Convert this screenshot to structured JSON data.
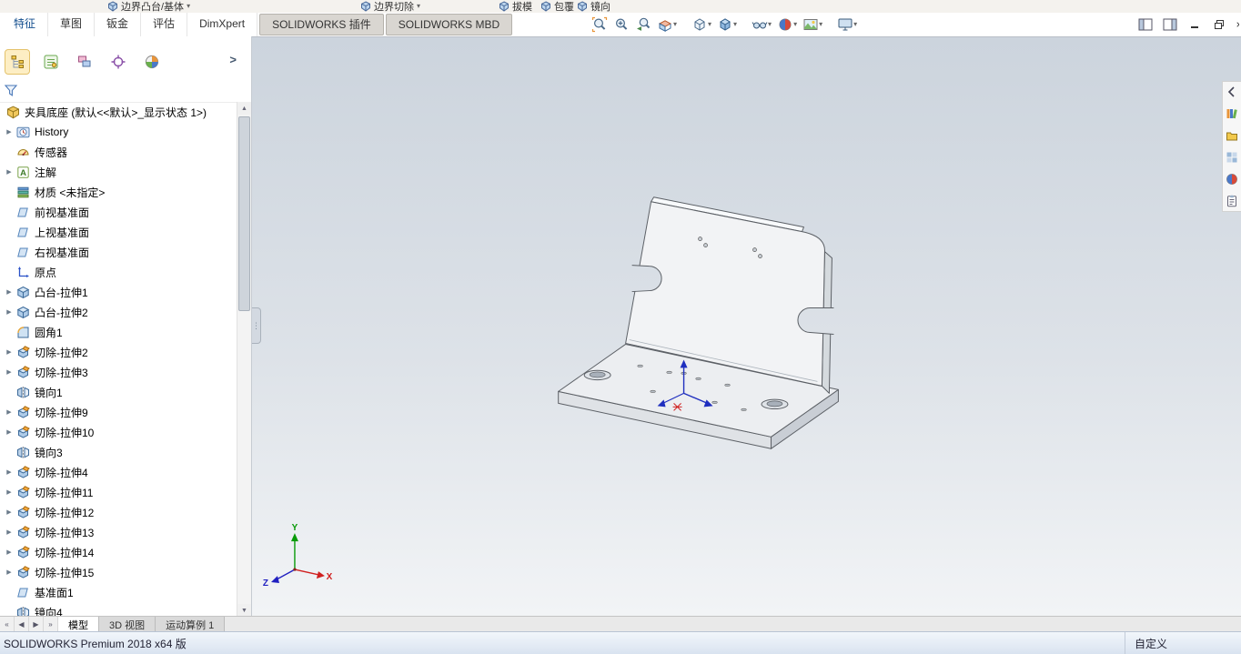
{
  "ribbon": {
    "fragments": [
      {
        "label": "边界凸台/基体",
        "caret": true
      },
      {
        "label": "边界切除",
        "caret": true
      },
      {
        "label": "拔模",
        "caret": false
      },
      {
        "label": "包覆",
        "caret": false
      },
      {
        "label": "镜向",
        "caret": false
      }
    ]
  },
  "command_tabs": {
    "items": [
      {
        "label": "特征",
        "active": true,
        "boxed": false
      },
      {
        "label": "草图",
        "active": false,
        "boxed": false
      },
      {
        "label": "钣金",
        "active": false,
        "boxed": false
      },
      {
        "label": "评估",
        "active": false,
        "boxed": false
      },
      {
        "label": "DimXpert",
        "active": false,
        "boxed": false
      },
      {
        "label": "SOLIDWORKS 插件",
        "active": false,
        "boxed": true
      },
      {
        "label": "SOLIDWORKS MBD",
        "active": false,
        "boxed": true
      }
    ]
  },
  "hud": {
    "buttons": [
      {
        "name": "zoom-fit",
        "caret": false,
        "gap": false
      },
      {
        "name": "zoom-area",
        "caret": false,
        "gap": false
      },
      {
        "name": "previous-view",
        "caret": false,
        "gap": false
      },
      {
        "name": "section-view",
        "caret": true,
        "gap": false
      },
      {
        "name": "view-orientation",
        "caret": true,
        "gap": true
      },
      {
        "name": "display-style",
        "caret": true,
        "gap": false
      },
      {
        "name": "hide-show-items",
        "caret": true,
        "gap": true
      },
      {
        "name": "edit-appearance",
        "caret": true,
        "gap": false
      },
      {
        "name": "apply-scene",
        "caret": true,
        "gap": false
      },
      {
        "name": "view-settings",
        "caret": true,
        "gap": true
      }
    ]
  },
  "window_controls": [
    "pane-left",
    "pane-right",
    "minimize",
    "restore",
    "close"
  ],
  "panel": {
    "manager_tabs": [
      "feature-manager",
      "property-manager",
      "configuration-manager",
      "dimxpert-manager",
      "display-manager"
    ],
    "chevron": ">",
    "filter_icon": "filter-funnel",
    "tree": {
      "items": [
        {
          "label": "夹具底座 (默认<<默认>_显示状态 1>)",
          "icon": "part",
          "expand": false,
          "root": true
        },
        {
          "label": "History",
          "icon": "history",
          "expand": true,
          "root": false
        },
        {
          "label": "传感器",
          "icon": "sensor",
          "expand": false,
          "root": false
        },
        {
          "label": "注解",
          "icon": "annotation",
          "expand": true,
          "root": false
        },
        {
          "label": "材质 <未指定>",
          "icon": "material",
          "expand": false,
          "root": false
        },
        {
          "label": "前视基准面",
          "icon": "plane",
          "expand": false,
          "root": false
        },
        {
          "label": "上视基准面",
          "icon": "plane",
          "expand": false,
          "root": false
        },
        {
          "label": "右视基准面",
          "icon": "plane",
          "expand": false,
          "root": false
        },
        {
          "label": "原点",
          "icon": "origin",
          "expand": false,
          "root": false
        },
        {
          "label": "凸台-拉伸1",
          "icon": "boss",
          "expand": true,
          "root": false
        },
        {
          "label": "凸台-拉伸2",
          "icon": "boss",
          "expand": true,
          "root": false
        },
        {
          "label": "圆角1",
          "icon": "fillet",
          "expand": false,
          "root": false
        },
        {
          "label": "切除-拉伸2",
          "icon": "cut",
          "expand": true,
          "root": false
        },
        {
          "label": "切除-拉伸3",
          "icon": "cut",
          "expand": true,
          "root": false
        },
        {
          "label": "镜向1",
          "icon": "mirror",
          "expand": false,
          "root": false
        },
        {
          "label": "切除-拉伸9",
          "icon": "cut",
          "expand": true,
          "root": false
        },
        {
          "label": "切除-拉伸10",
          "icon": "cut",
          "expand": true,
          "root": false
        },
        {
          "label": "镜向3",
          "icon": "mirror",
          "expand": false,
          "root": false
        },
        {
          "label": "切除-拉伸4",
          "icon": "cut",
          "expand": true,
          "root": false
        },
        {
          "label": "切除-拉伸11",
          "icon": "cut",
          "expand": true,
          "root": false
        },
        {
          "label": "切除-拉伸12",
          "icon": "cut",
          "expand": true,
          "root": false
        },
        {
          "label": "切除-拉伸13",
          "icon": "cut",
          "expand": true,
          "root": false
        },
        {
          "label": "切除-拉伸14",
          "icon": "cut",
          "expand": true,
          "root": false
        },
        {
          "label": "切除-拉伸15",
          "icon": "cut",
          "expand": true,
          "root": false
        },
        {
          "label": "基准面1",
          "icon": "plane",
          "expand": false,
          "root": false
        },
        {
          "label": "镜向4",
          "icon": "mirror",
          "expand": false,
          "root": false
        }
      ]
    }
  },
  "task_pane": {
    "icons": [
      "collapse-arrow",
      "design-library",
      "file-explorer",
      "view-palette",
      "appearances",
      "custom-properties"
    ]
  },
  "sheet_bar": {
    "nav": [
      "first",
      "prev",
      "next",
      "last"
    ],
    "tabs": [
      {
        "label": "模型",
        "active": true
      },
      {
        "label": "3D 视图",
        "active": false
      },
      {
        "label": "运动算例 1",
        "active": false
      }
    ]
  },
  "status": {
    "left": "SOLIDWORKS Premium 2018 x64 版",
    "right": "自定义"
  },
  "triad": {
    "x": "X",
    "y": "Y",
    "z": "Z"
  }
}
